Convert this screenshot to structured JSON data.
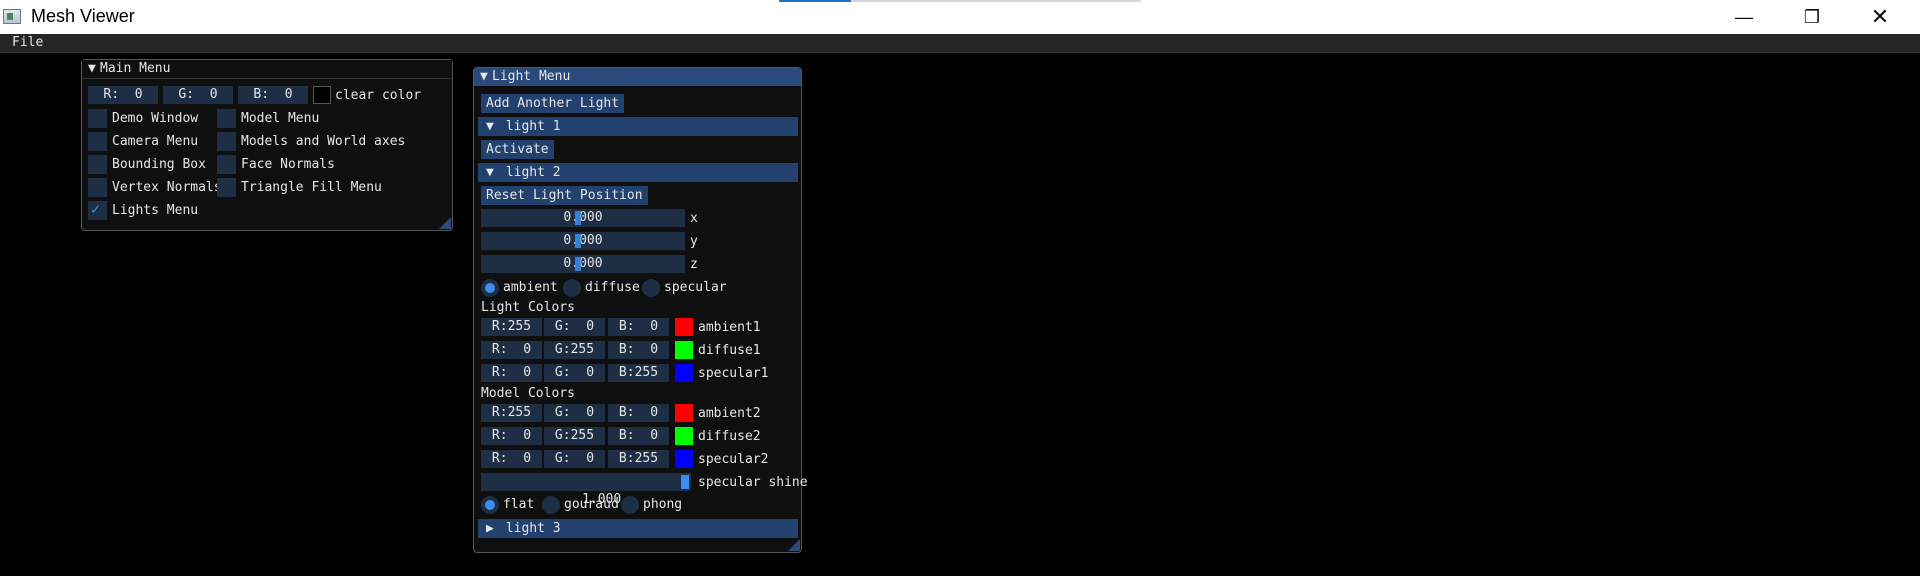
{
  "window": {
    "title": "Mesh Viewer",
    "minimize_icon": "minimize-icon",
    "maximize_icon": "restore-icon",
    "close_icon": "close-icon"
  },
  "menubar": {
    "file": "File"
  },
  "main_menu": {
    "title": "Main Menu",
    "clear_color": {
      "r": "R:  0",
      "g": "G:  0",
      "b": "B:  0",
      "label": "clear color",
      "swatch": "#000000"
    },
    "checkboxes": [
      {
        "label": "Demo Window",
        "checked": false
      },
      {
        "label": "Model Menu",
        "checked": false
      },
      {
        "label": "Camera Menu",
        "checked": false
      },
      {
        "label": "Models and World axes",
        "checked": false
      },
      {
        "label": "Bounding Box",
        "checked": false
      },
      {
        "label": "Face Normals",
        "checked": false
      },
      {
        "label": "Vertex Normals",
        "checked": false
      },
      {
        "label": "Triangle Fill Menu",
        "checked": false
      },
      {
        "label": "Lights Menu",
        "checked": true
      }
    ]
  },
  "light_menu": {
    "title": "Light Menu",
    "add_button": "Add Another Light",
    "light1": {
      "label": "light 1",
      "activate": "Activate"
    },
    "light2": {
      "label": "light 2",
      "reset_button": "Reset Light Position",
      "position": [
        {
          "value": "0.000",
          "axis": "x",
          "level": 0.5
        },
        {
          "value": "0.000",
          "axis": "y",
          "level": 0.5
        },
        {
          "value": "0.000",
          "axis": "z",
          "level": 0.5
        }
      ],
      "light_type": {
        "options": [
          "ambient",
          "diffuse",
          "specular"
        ],
        "selected": "ambient"
      },
      "light_colors_heading": "Light Colors",
      "light_colors": [
        {
          "r": "R:255",
          "g": "G:  0",
          "b": "B:  0",
          "label": "ambient1",
          "swatch": "#ff0000"
        },
        {
          "r": "R:  0",
          "g": "G:255",
          "b": "B:  0",
          "label": "diffuse1",
          "swatch": "#00ff00"
        },
        {
          "r": "R:  0",
          "g": "G:  0",
          "b": "B:255",
          "label": "specular1",
          "swatch": "#0000ff"
        }
      ],
      "model_colors_heading": "Model Colors",
      "model_colors": [
        {
          "r": "R:255",
          "g": "G:  0",
          "b": "B:  0",
          "label": "ambient2",
          "swatch": "#ff0000"
        },
        {
          "r": "R:  0",
          "g": "G:255",
          "b": "B:  0",
          "label": "diffuse2",
          "swatch": "#00ff00"
        },
        {
          "r": "R:  0",
          "g": "G:  0",
          "b": "B:255",
          "label": "specular2",
          "swatch": "#0000ff"
        }
      ],
      "specular_shine": {
        "value": "1.000",
        "label": "specular shine",
        "level": 1.0
      },
      "shading": {
        "options": [
          "flat",
          "gouraud",
          "phong"
        ],
        "selected": "flat"
      }
    },
    "light3": {
      "label": "light 3"
    }
  },
  "colors": {
    "accent": "#3b8ef0",
    "frame_bg": "#1e2e44",
    "header_bg": "#22416e",
    "title_active": "#294a7a"
  }
}
